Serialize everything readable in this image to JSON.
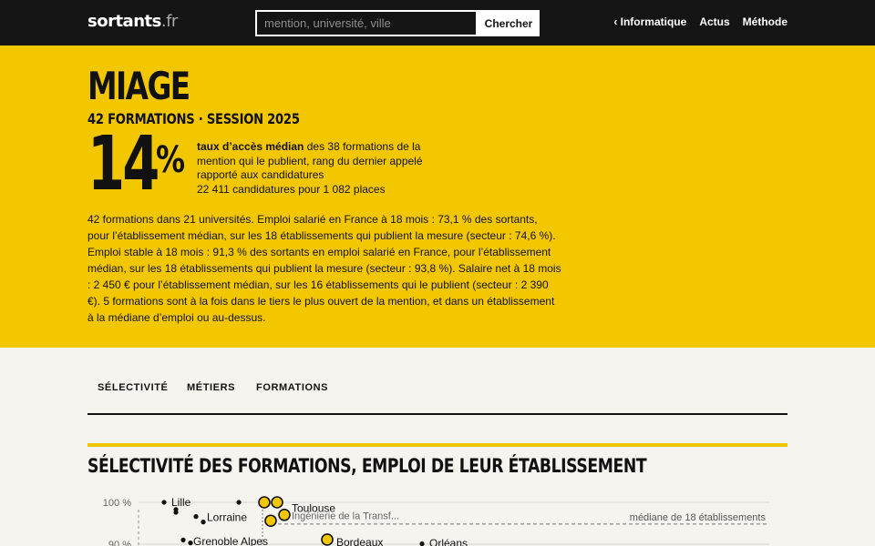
{
  "header": {
    "logo_main": "sortants",
    "logo_tld": ".fr",
    "search_placeholder": "mention, université, ville",
    "search_button": "Chercher",
    "nav": [
      "‹ Informatique",
      "Actus",
      "Méthode"
    ]
  },
  "hero": {
    "title": "MIAGE",
    "subtitle": "42 FORMATIONS · SESSION 2025",
    "stat_value": "14",
    "stat_unit": "%",
    "stat_desc_bold": "taux d’accès médian",
    "stat_desc_rest": " des 38 formations de la mention qui le publient, rang du dernier appelé rapporté aux candidatures",
    "stat_desc_line2": "22 411 candidatures pour 1 082 places",
    "summary": "42 formations dans 21 universités. Emploi salarié en France à 18 mois : 73,1 % des sortants, pour l’établissement médian, sur les 18 établissements qui publient la mesure (secteur : 74,6 %). Emploi stable à 18 mois : 91,3 % des sortants en emploi salarié en France, pour l’établissement médian, sur les 18 établissements qui publient la mesure (secteur : 93,8 %). Salaire net à 18 mois : 2 450 € pour l’établissement médian, sur les 16 établissements qui le publient (secteur : 2 390 €). 5 formations sont à la fois dans le tiers le plus ouvert de la mention, et dans un établissement à la médiane d’emploi ou au-dessus."
  },
  "tabs": [
    "SÉLECTIVITÉ",
    "MÉTIERS",
    "FORMATIONS"
  ],
  "section": {
    "title": "SÉLECTIVITÉ DES FORMATIONS, EMPLOI DE LEUR ÉTABLISSEMENT"
  },
  "chart_data": {
    "type": "scatter",
    "title": "SÉLECTIVITÉ DES FORMATIONS, EMPLOI DE LEUR ÉTABLISSEMENT",
    "y_ticks": [
      "100 %",
      "90 %"
    ],
    "ylim": [
      90,
      100
    ],
    "median_label": "médiane de 18 établissements",
    "median_y": 94.8,
    "point_labels": [
      {
        "text": "Lille",
        "y": 100
      },
      {
        "text": "Toulouse",
        "y": 98.6
      },
      {
        "text": "Ingénierie de la Transf...",
        "y": 96.8
      },
      {
        "text": "Lorraine",
        "y": 96.4
      },
      {
        "text": "Grenoble Alpes",
        "y": 90.6
      },
      {
        "text": "Bordeaux",
        "y": 90.4
      },
      {
        "text": "Orléans",
        "y": 90.2
      }
    ],
    "highlight_color": "#f3c700",
    "accent_color": "#f3c700"
  }
}
